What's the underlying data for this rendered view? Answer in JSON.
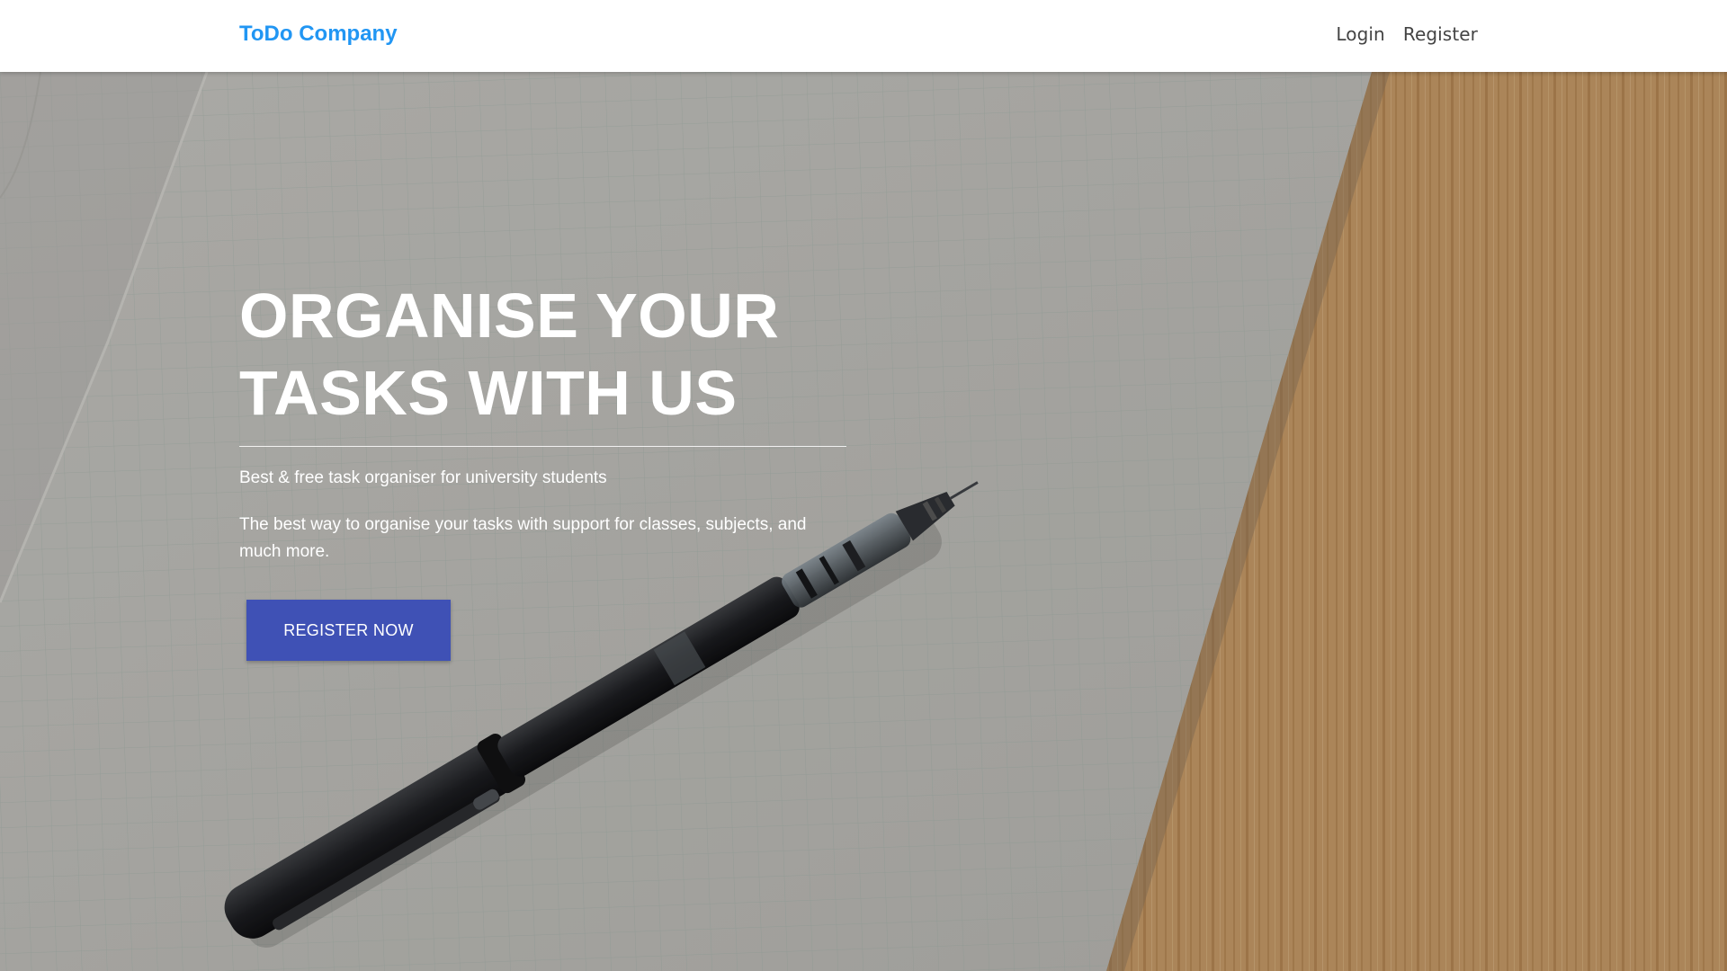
{
  "navbar": {
    "brand": "ToDo Company",
    "links": [
      {
        "label": "Login"
      },
      {
        "label": "Register"
      }
    ]
  },
  "hero": {
    "title_line1": "ORGANISE YOUR",
    "title_line2": "TASKS WITH US",
    "subtitle": "Best & free task organiser for university students",
    "description": "The best way to organise your tasks with support for classes, subjects, and much more.",
    "cta_label": "REGISTER NOW"
  },
  "colors": {
    "brand": "#2196f3",
    "cta_background": "#3f51b5",
    "navbar_background": "#ffffff",
    "hero_text": "#ffffff"
  },
  "icons": {
    "background_image": "notebook-pen-photo"
  }
}
